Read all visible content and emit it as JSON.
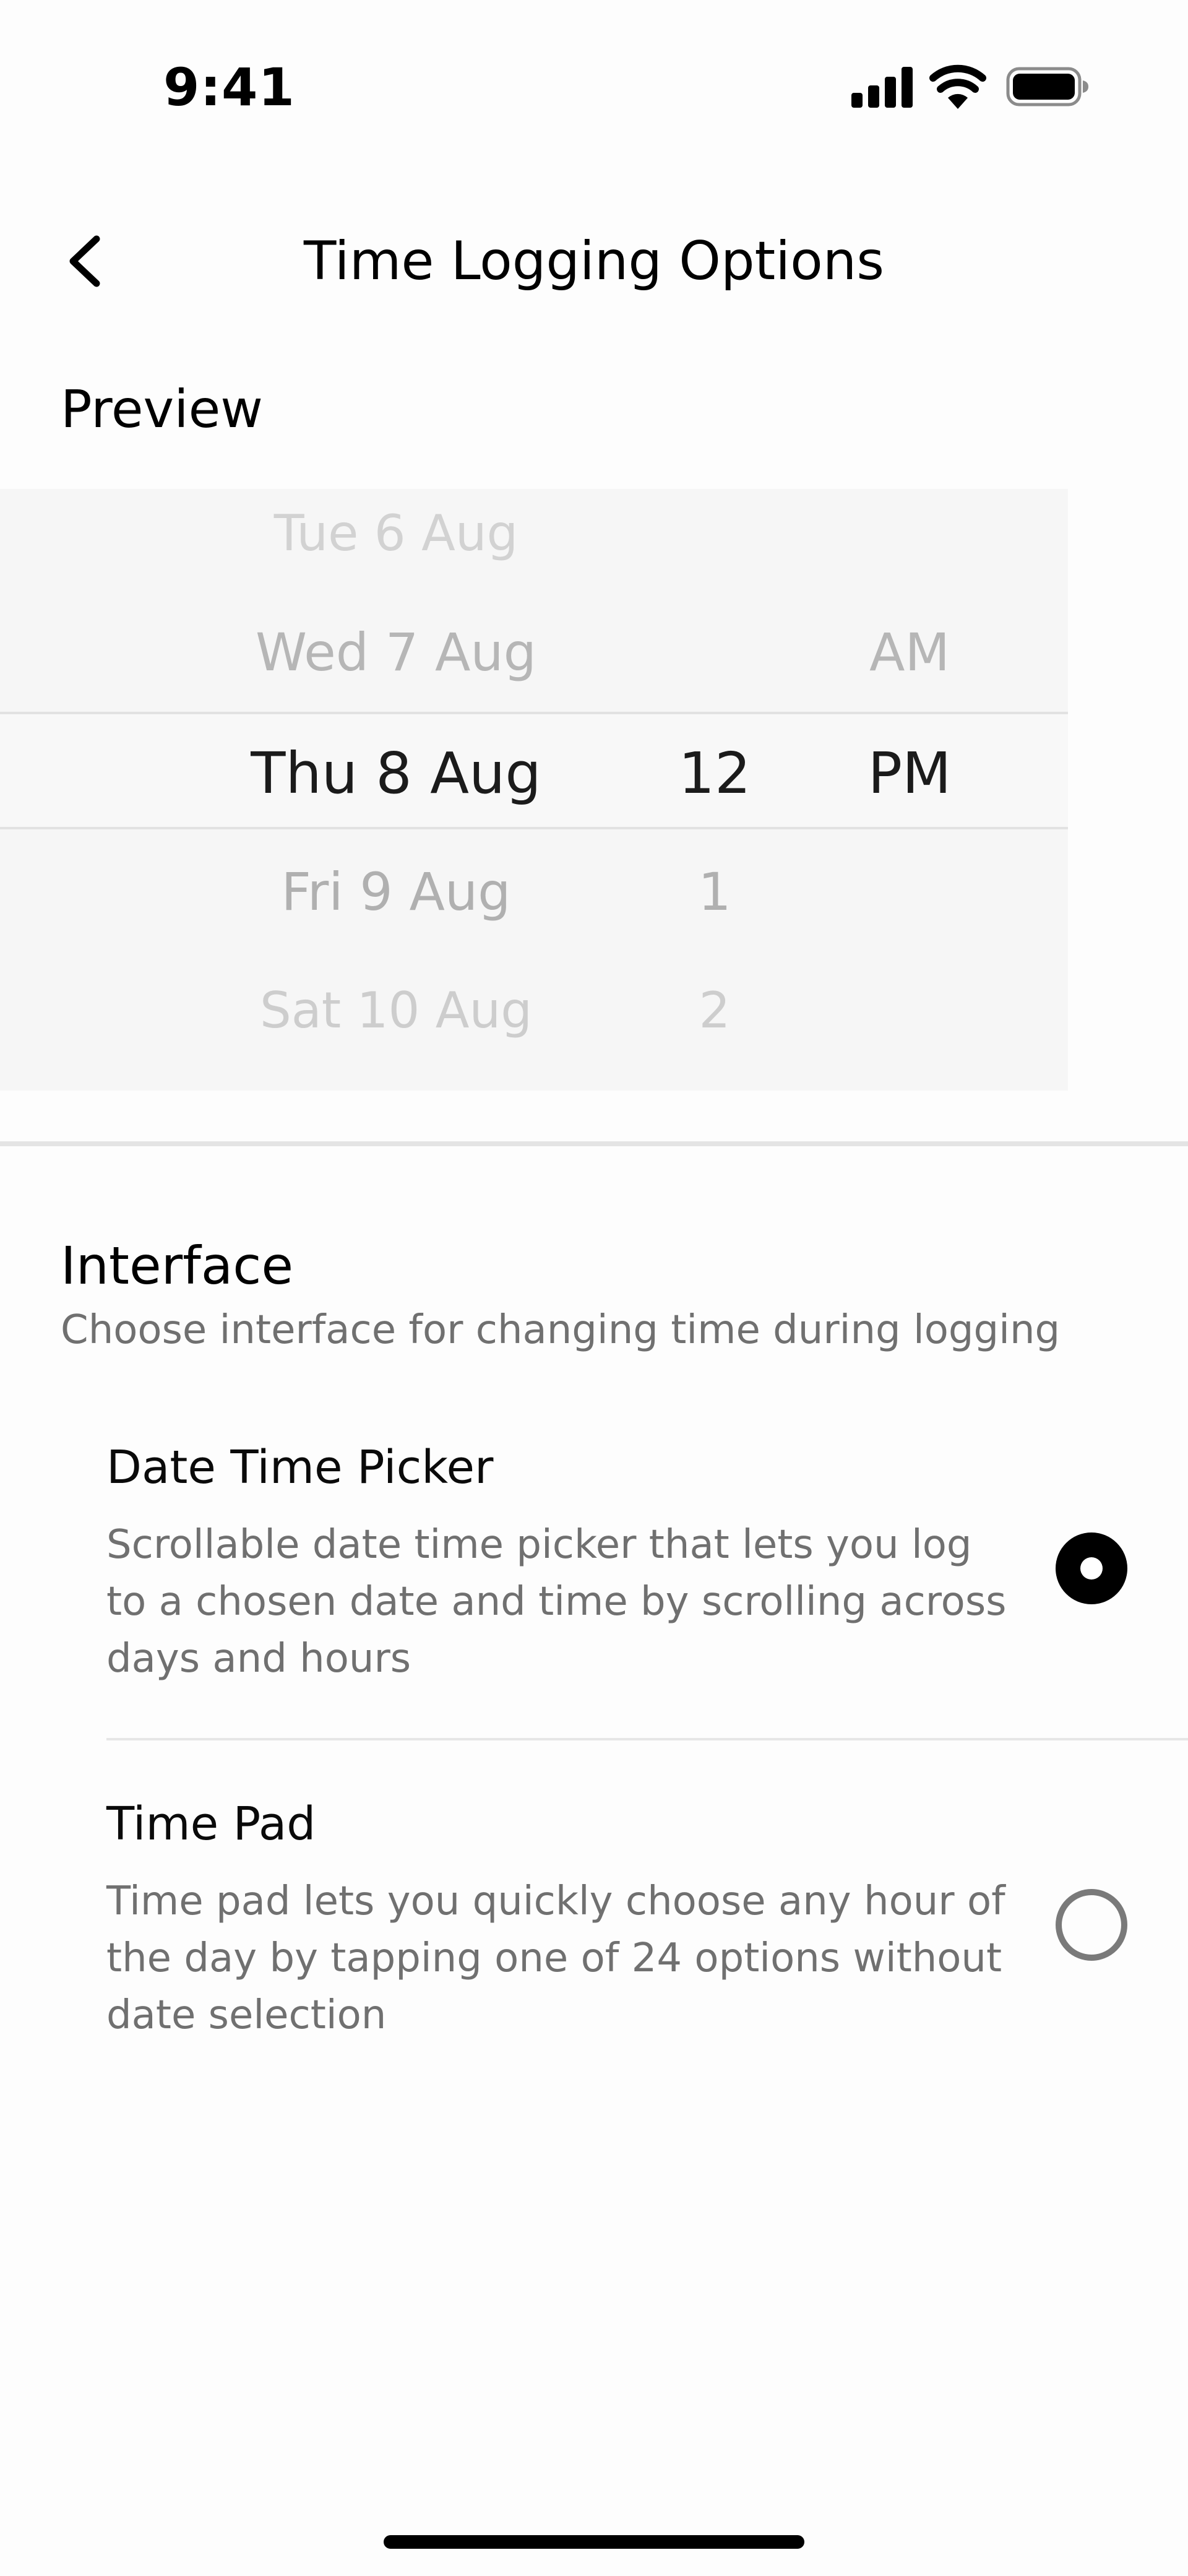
{
  "status_bar": {
    "time": "9:41",
    "icons": [
      "cellular-signal-icon",
      "wifi-icon",
      "battery-icon"
    ]
  },
  "header": {
    "title": "Time Logging Options",
    "back_icon": "chevron-left-icon"
  },
  "preview": {
    "label": "Preview",
    "picker": {
      "days": [
        "Tue 6 Aug",
        "Wed 7 Aug",
        "Thu 8 Aug",
        "Fri 9 Aug",
        "Sat 10 Aug"
      ],
      "hours": [
        "12",
        "1",
        "2"
      ],
      "ampm": [
        "AM",
        "PM"
      ],
      "selected": {
        "day": "Thu 8 Aug",
        "hour": "12",
        "ampm": "PM"
      }
    }
  },
  "interface": {
    "title": "Interface",
    "subtitle": "Choose interface for changing time during logging",
    "options": [
      {
        "title": "Date Time Picker",
        "description": "Scrollable date time picker that lets you log to a chosen date and time by scrolling across days and hours",
        "selected": true
      },
      {
        "title": "Time Pad",
        "description": "Time pad lets you quickly choose any hour of the day by tapping one of 24 options without date selection",
        "selected": false
      }
    ]
  }
}
